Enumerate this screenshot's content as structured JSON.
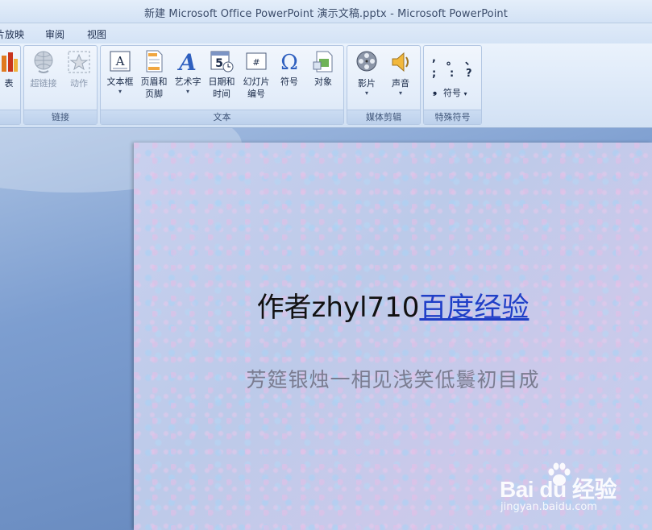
{
  "window": {
    "title": "新建 Microsoft Office PowerPoint 演示文稿.pptx - Microsoft PowerPoint"
  },
  "tabs": [
    {
      "label": "灯片放映"
    },
    {
      "label": "审阅"
    },
    {
      "label": "视图"
    }
  ],
  "ribbon": {
    "partial": {
      "label": "表"
    },
    "links": {
      "group_label": "链接",
      "hyperlink": "超链接",
      "action": "动作"
    },
    "text": {
      "group_label": "文本",
      "textbox_label": "文本框",
      "header_footer_line1": "页眉和",
      "header_footer_line2": "页脚",
      "wordart_label": "艺术字",
      "datetime_line1": "日期和",
      "datetime_line2": "时间",
      "slide_number_line1": "幻灯片",
      "slide_number_line2": "编号",
      "symbol_label": "符号",
      "object_label": "对象"
    },
    "media": {
      "group_label": "媒体剪辑",
      "movie_label": "影片",
      "sound_label": "声音"
    },
    "special": {
      "group_label": "特殊符号",
      "symbols": [
        ",",
        "。",
        "、",
        ";",
        ":",
        "?",
        "❟"
      ],
      "symbol_button": "符号"
    },
    "icons": {
      "textbox": "A",
      "symbol": "Ω",
      "datetime": "5",
      "slide_number": "#"
    }
  },
  "slide": {
    "title_prefix": "作者zhyl710",
    "title_link": "百度经验",
    "subtitle": "芳筵银烛一相见浅笑低鬟初目成"
  },
  "watermark": {
    "logo": "Bai du 经验",
    "url": "jingyan.baidu.com"
  },
  "colors": {
    "accent": "#1f3fc7",
    "ribbon": "#dde9f8",
    "stage": "#6d8fbf"
  }
}
